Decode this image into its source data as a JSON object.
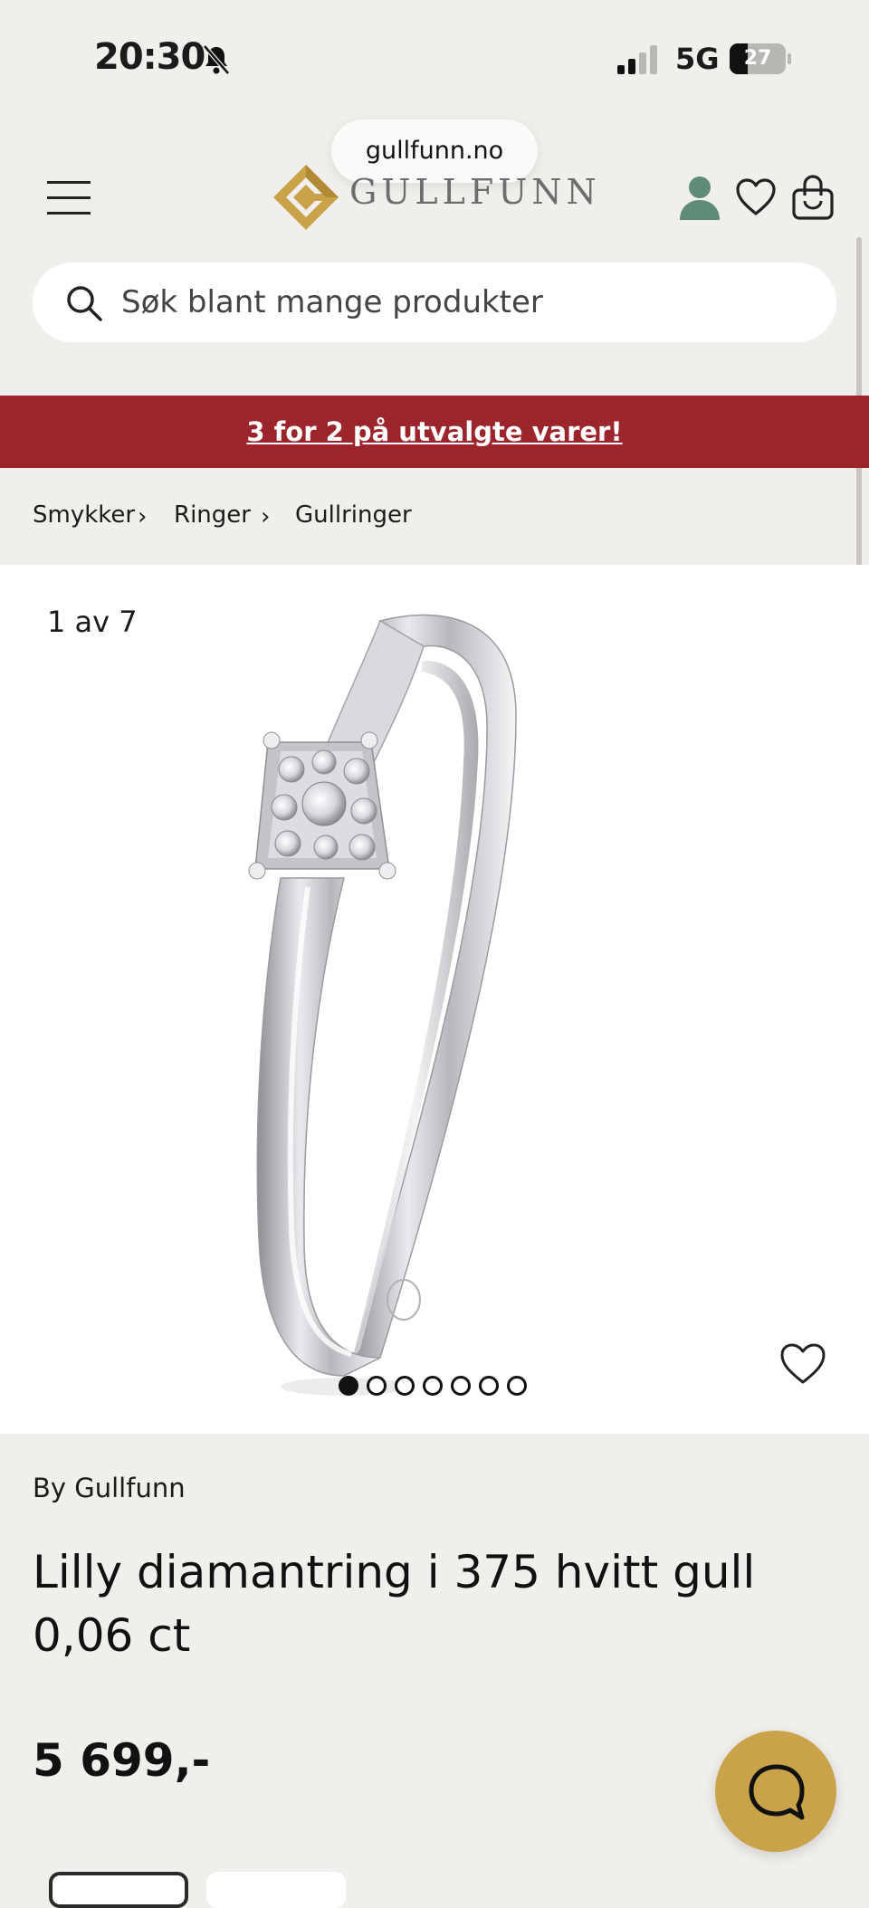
{
  "status_bar": {
    "time": "20:30",
    "network": "5G",
    "battery": "27",
    "icons": [
      "bell-muted-icon",
      "signal-icon",
      "battery-icon"
    ]
  },
  "browser": {
    "url": "gullfunn.no"
  },
  "header": {
    "logo_text": "GULLFUNN",
    "icons": [
      "menu-icon",
      "account-icon",
      "heart-icon",
      "cart-icon"
    ]
  },
  "search": {
    "placeholder": "Søk blant mange produkter"
  },
  "promo": {
    "text": "3 for 2 på utvalgte varer!"
  },
  "breadcrumb": [
    "Smykker",
    "Ringer",
    "Gullringer"
  ],
  "gallery": {
    "counter": "1 av 7",
    "image_count": 7,
    "active_index": 0
  },
  "product": {
    "brand": "By Gullfunn",
    "title": "Lilly diamantring i 375 hvitt gull 0,06 ct",
    "price": "5 699,-"
  },
  "colors": {
    "promo_red": "#9c242b",
    "gold": "#c9a24a",
    "account_green": "#5f8c78",
    "background": "#f1efec"
  }
}
